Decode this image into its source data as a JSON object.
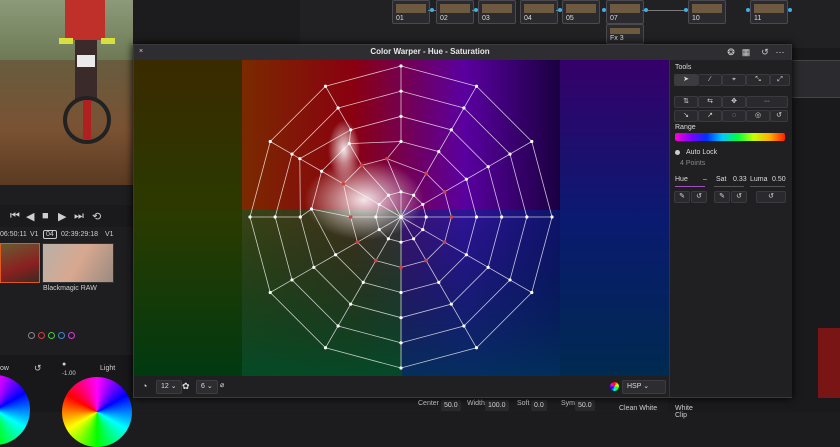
{
  "nodes": [
    {
      "label": "01"
    },
    {
      "label": "02"
    },
    {
      "label": "03"
    },
    {
      "label": "04"
    },
    {
      "label": "05"
    },
    {
      "label": "07"
    },
    {
      "label": "10"
    },
    {
      "label": "11"
    }
  ],
  "node_fx_label": "Fx 3",
  "timeline": {
    "tc_left": "06:50:11",
    "track_v1": "V1",
    "clip_index": "04",
    "tc_right": "02:39:29:18",
    "track_v1b": "V1",
    "clip_name": "Blackmagic RAW"
  },
  "wheels": {
    "left_label": "ow",
    "right_label": "Light",
    "value": "-1.00"
  },
  "dialog": {
    "title": "Color Warper - Hue - Saturation",
    "footer": {
      "hue_divisions": "12",
      "sat_divisions": "6",
      "mode": "HSP"
    }
  },
  "tools": {
    "heading": "Tools",
    "range_label": "Range",
    "auto_lock": "Auto Lock",
    "points": "4 Points",
    "hue_label": "Hue",
    "hue_value": "–",
    "sat_label": "Sat",
    "sat_value": "0.33",
    "luma_label": "Luma",
    "luma_value": "0.50"
  },
  "bottom": {
    "center_label": "Center",
    "center_value": "50.0",
    "width_label": "Width",
    "width_value": "100.0",
    "soft_label": "Soft",
    "soft_value": "0.0",
    "sym_label": "Sym",
    "sym_value": "50.0",
    "clean_white": "Clean White",
    "white_clip": "White Clip"
  },
  "colors": {
    "accent": "#3fb0e6",
    "dialog_bg": "#26262a"
  }
}
